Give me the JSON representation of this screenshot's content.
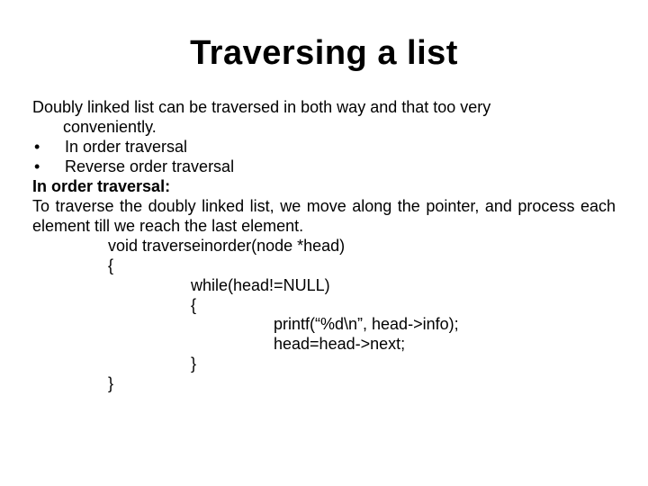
{
  "title": "Traversing a list",
  "intro_line1": "Doubly linked list can be traversed in both way and that too very",
  "intro_line2": "conveniently.",
  "bullets": {
    "b1": "In order traversal",
    "b2": "Reverse order traversal"
  },
  "subhead": "In order traversal:",
  "para": "To traverse the doubly linked list, we move along the pointer, and process each element till we reach the last element.",
  "code": {
    "l1": "void traverseinorder(node *head)",
    "l2": "{",
    "l3": "while(head!=NULL)",
    "l4": "{",
    "l5": "printf(“%d\\n”, head->info);",
    "l6": "head=head->next;",
    "l7": "}",
    "l8": "}"
  },
  "bullet_char": "•"
}
